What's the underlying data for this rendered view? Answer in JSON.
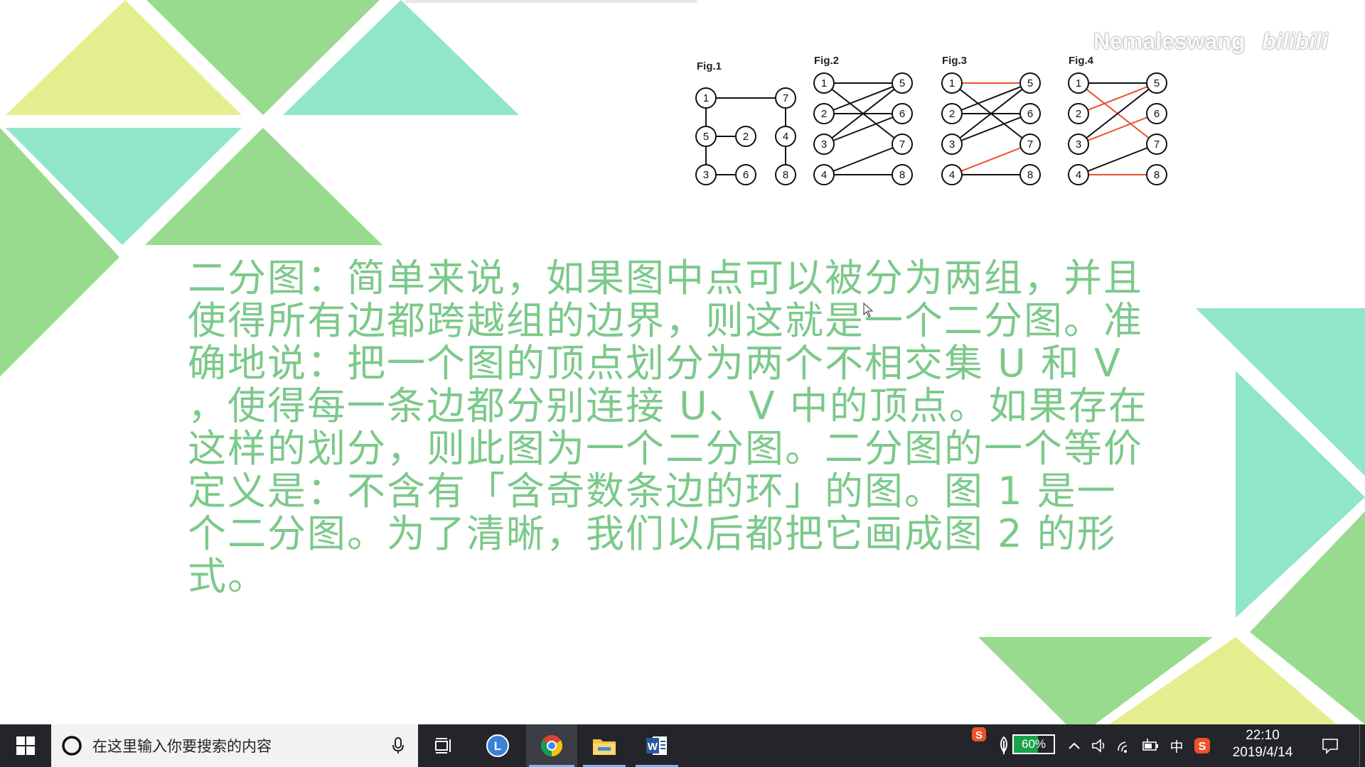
{
  "slide": {
    "paragraph": "二分图：简单来说，如果图中点可以被分为两组，并且使得所有边都跨越组的边界，则这就是一个二分图。准确地说：把一个图的顶点划分为两个不相交集 U 和 V ，使得每一条边都分别连接 U、V 中的顶点。如果存在这样的划分，则此图为一个二分图。二分图的一个等价定义是：不含有「含奇数条边的环」的图。图 1 是一个二分图。为了清晰，我们以后都把它画成图 2 的形式。",
    "figures": [
      {
        "label": "Fig.1",
        "nodes": [
          "1",
          "5",
          "3",
          "7",
          "2",
          "6",
          "4",
          "8"
        ]
      },
      {
        "label": "Fig.2",
        "nodes": [
          "1",
          "2",
          "3",
          "4",
          "5",
          "6",
          "7",
          "8"
        ]
      },
      {
        "label": "Fig.3",
        "nodes": [
          "1",
          "2",
          "3",
          "4",
          "5",
          "6",
          "7",
          "8"
        ]
      },
      {
        "label": "Fig.4",
        "nodes": [
          "1",
          "2",
          "3",
          "4",
          "5",
          "6",
          "7",
          "8"
        ]
      }
    ],
    "highlight_edge_color": "#e8502a",
    "text_color": "#7cc98a"
  },
  "watermark": {
    "user": "Nemaleswang",
    "brand": "bilibili"
  },
  "taskbar": {
    "search_placeholder": "在这里输入你要搜索的内容",
    "apps": [
      "task-view",
      "L",
      "chrome",
      "file-explorer",
      "word"
    ],
    "battery_percent": "60%",
    "ime_label": "中",
    "clock_time": "22:10",
    "clock_date": "2019/4/14"
  }
}
